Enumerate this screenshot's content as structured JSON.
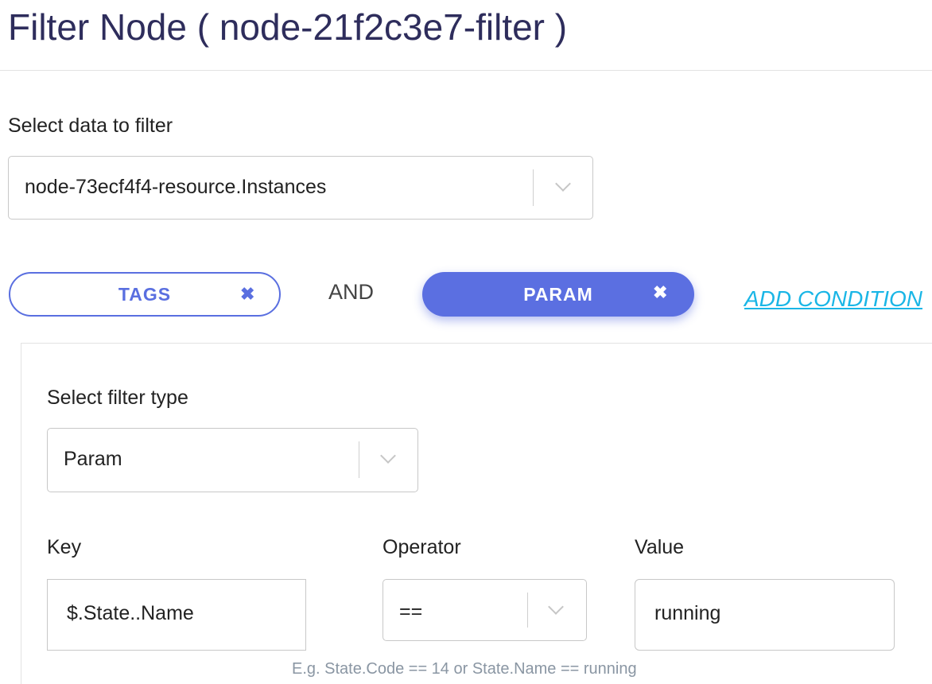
{
  "header": {
    "title": "Filter Node ( node-21f2c3e7-filter )"
  },
  "data_select": {
    "label": "Select data to filter",
    "value": "node-73ecf4f4-resource.Instances"
  },
  "conditions": {
    "items": [
      {
        "label": "TAGS",
        "remove": "✖",
        "active": false
      },
      {
        "label": "PARAM",
        "remove": "✖",
        "active": true
      }
    ],
    "joiner": "AND",
    "add_label": "ADD CONDITION"
  },
  "filter": {
    "type_label": "Select filter type",
    "type_value": "Param",
    "key_label": "Key",
    "key_value": "$.State..Name",
    "operator_label": "Operator",
    "operator_value": "==",
    "value_label": "Value",
    "value_value": "running",
    "hint": "E.g. State.Code == 14 or State.Name == running"
  },
  "colors": {
    "accent": "#5b6fe1",
    "link": "#1ab6e6",
    "title": "#2e2d5c",
    "hint": "#8a96a3"
  },
  "icons": {
    "remove": "close-icon",
    "dropdown": "chevron-down-icon"
  }
}
